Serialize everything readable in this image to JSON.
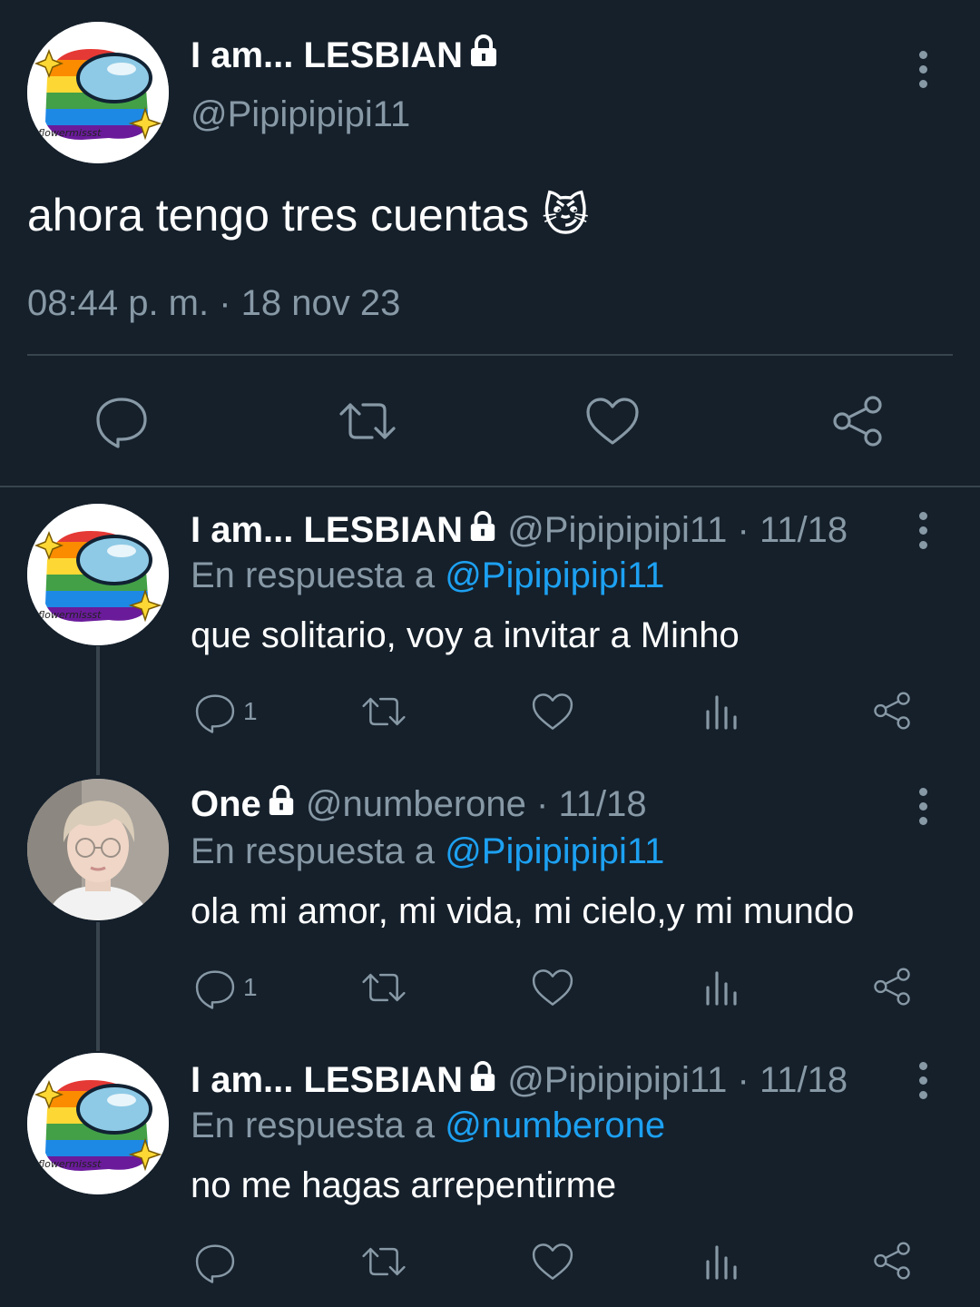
{
  "main_tweet": {
    "display_name": "I am... LESBIAN",
    "handle": "@Pipipipipi11",
    "avatar_caption": "flowermissst",
    "text": "ahora tengo tres cuentas",
    "emoji": "😼",
    "timestamp": "08:44 p. m. · 18 nov 23"
  },
  "replies": [
    {
      "display_name": "I am... LESBIAN",
      "handle": "@Pipipipipi11",
      "date": "· 11/18",
      "reply_prefix": "En respuesta a",
      "reply_to": "@Pipipipipi11",
      "text": "que solitario, voy a invitar a Minho",
      "reply_count": "1",
      "avatar_caption": "flowermissst"
    },
    {
      "display_name": "One",
      "handle": "@numberone",
      "date": "· 11/18",
      "reply_prefix": "En respuesta a",
      "reply_to": "@Pipipipipi11",
      "text": "ola mi amor, mi vida, mi cielo,y mi mundo",
      "reply_count": "1"
    },
    {
      "display_name": "I am... LESBIAN",
      "handle": "@Pipipipipi11",
      "date": "· 11/18",
      "reply_prefix": "En respuesta a",
      "reply_to": "@numberone",
      "text": "no me hagas arrepentirme",
      "reply_count": "",
      "avatar_caption": "flowermissst"
    }
  ],
  "colors": {
    "background": "#15202b",
    "muted": "#8899a6",
    "link": "#1da1f2",
    "divider": "#38444d"
  },
  "icons": [
    "lock-icon",
    "more-options-icon",
    "reply-icon",
    "retweet-icon",
    "like-icon",
    "share-icon",
    "analytics-icon"
  ]
}
